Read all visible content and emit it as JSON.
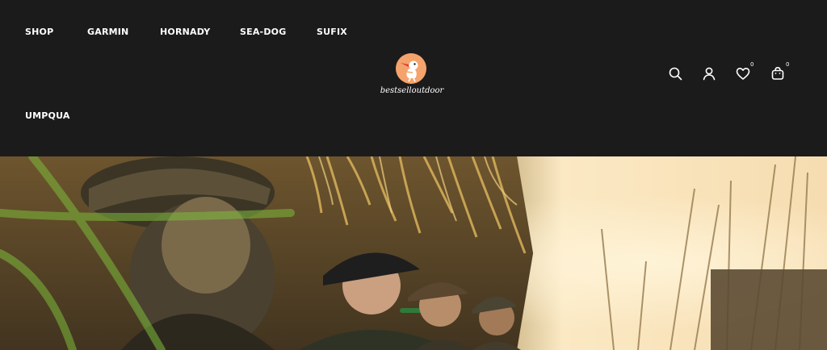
{
  "nav": {
    "items": [
      {
        "label": "SHOP"
      },
      {
        "label": "GARMIN"
      },
      {
        "label": "HORNADY"
      },
      {
        "label": "SEA-DOG"
      },
      {
        "label": "SUFIX"
      },
      {
        "label": "UMPQUA"
      }
    ]
  },
  "logo": {
    "text": "bestselloutdoor",
    "icon": "stork-logo-icon",
    "badge_color": "#f4a36c"
  },
  "header_actions": {
    "search_icon": "search-icon",
    "account_icon": "user-icon",
    "wishlist_icon": "heart-icon",
    "wishlist_count": "0",
    "cart_icon": "bag-icon",
    "cart_count": "0"
  },
  "colors": {
    "header_bg": "#1b1b1b",
    "text": "#ffffff"
  }
}
